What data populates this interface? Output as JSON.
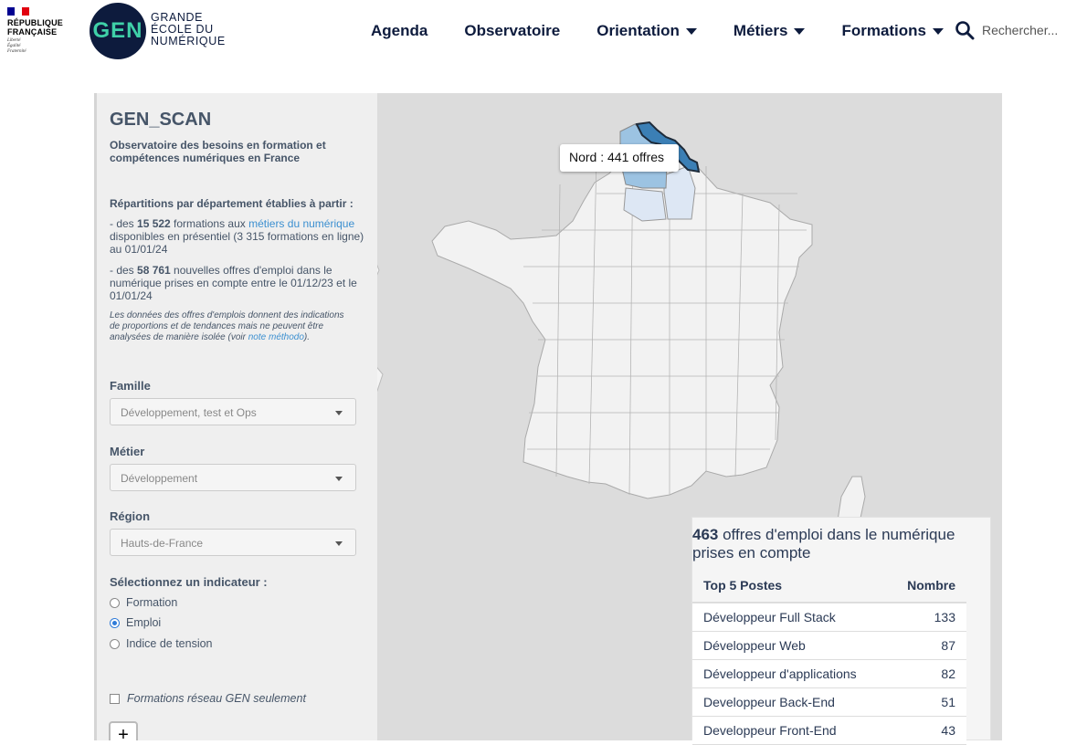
{
  "header": {
    "rf_line1": "RÉPUBLIQUE",
    "rf_line2": "FRANÇAISE",
    "rf_motto": "Liberté\nÉgalité\nFraternité",
    "gen_logo_text": "GEN",
    "gen_name_1": "GRANDE",
    "gen_name_2": "ÉCOLE DU",
    "gen_name_3": "NUMÉRIQUE",
    "nav": [
      {
        "label": "Agenda",
        "dropdown": false
      },
      {
        "label": "Observatoire",
        "dropdown": false
      },
      {
        "label": "Orientation",
        "dropdown": true
      },
      {
        "label": "Métiers",
        "dropdown": true
      },
      {
        "label": "Formations",
        "dropdown": true
      }
    ],
    "search_label": "Rechercher..."
  },
  "panel": {
    "title": "GEN_SCAN",
    "subtitle": "Observatoire des besoins en formation et compétences numériques en France",
    "repartition_title": "Répartitions par département établies à partir :",
    "bullet1_pre": "- des ",
    "bullet1_count": "15 522",
    "bullet1_mid": " formations aux ",
    "bullet1_link": "métiers du numérique",
    "bullet1_post": " disponibles en présentiel (3 315 formations en ligne) au 01/01/24",
    "bullet2_pre": "- des ",
    "bullet2_count": "58 761",
    "bullet2_post": " nouvelles offres d'emploi dans le numérique prises en compte entre le 01/12/23 et le 01/01/24",
    "note_pre": "Les données des offres d'emplois donnent des indications de proportions et de tendances mais ne peuvent être analysées de manière isolée (voir ",
    "note_link": "note méthodo",
    "note_post": ").",
    "famille_label": "Famille",
    "famille_value": "Développement, test et Ops",
    "metier_label": "Métier",
    "metier_value": "Développement",
    "region_label": "Région",
    "region_value": "Hauts-de-France",
    "indicator_label": "Sélectionnez un indicateur :",
    "indicators": [
      {
        "label": "Formation",
        "selected": false
      },
      {
        "label": "Emploi",
        "selected": true
      },
      {
        "label": "Indice de tension",
        "selected": false
      }
    ],
    "gen_only_label": "Formations réseau GEN seulement",
    "gen_only_checked": false,
    "zoom_in": "+"
  },
  "map": {
    "tooltip": "Nord : 441 offres",
    "highlight_color": "#3b7fb5",
    "light_color": "#9cc3e2",
    "pale_color": "#dde7f4"
  },
  "stats": {
    "count": "463",
    "headline": " offres d'emploi dans le numérique prises en compte",
    "col_post": "Top 5 Postes",
    "col_num": "Nombre",
    "rows": [
      {
        "poste": "Développeur Full Stack",
        "nombre": "133"
      },
      {
        "poste": "Développeur Web",
        "nombre": "87"
      },
      {
        "poste": "Développeur d'applications",
        "nombre": "82"
      },
      {
        "poste": "Developpeur Back-End",
        "nombre": "51"
      },
      {
        "poste": "Developpeur Front-End",
        "nombre": "43"
      }
    ]
  }
}
